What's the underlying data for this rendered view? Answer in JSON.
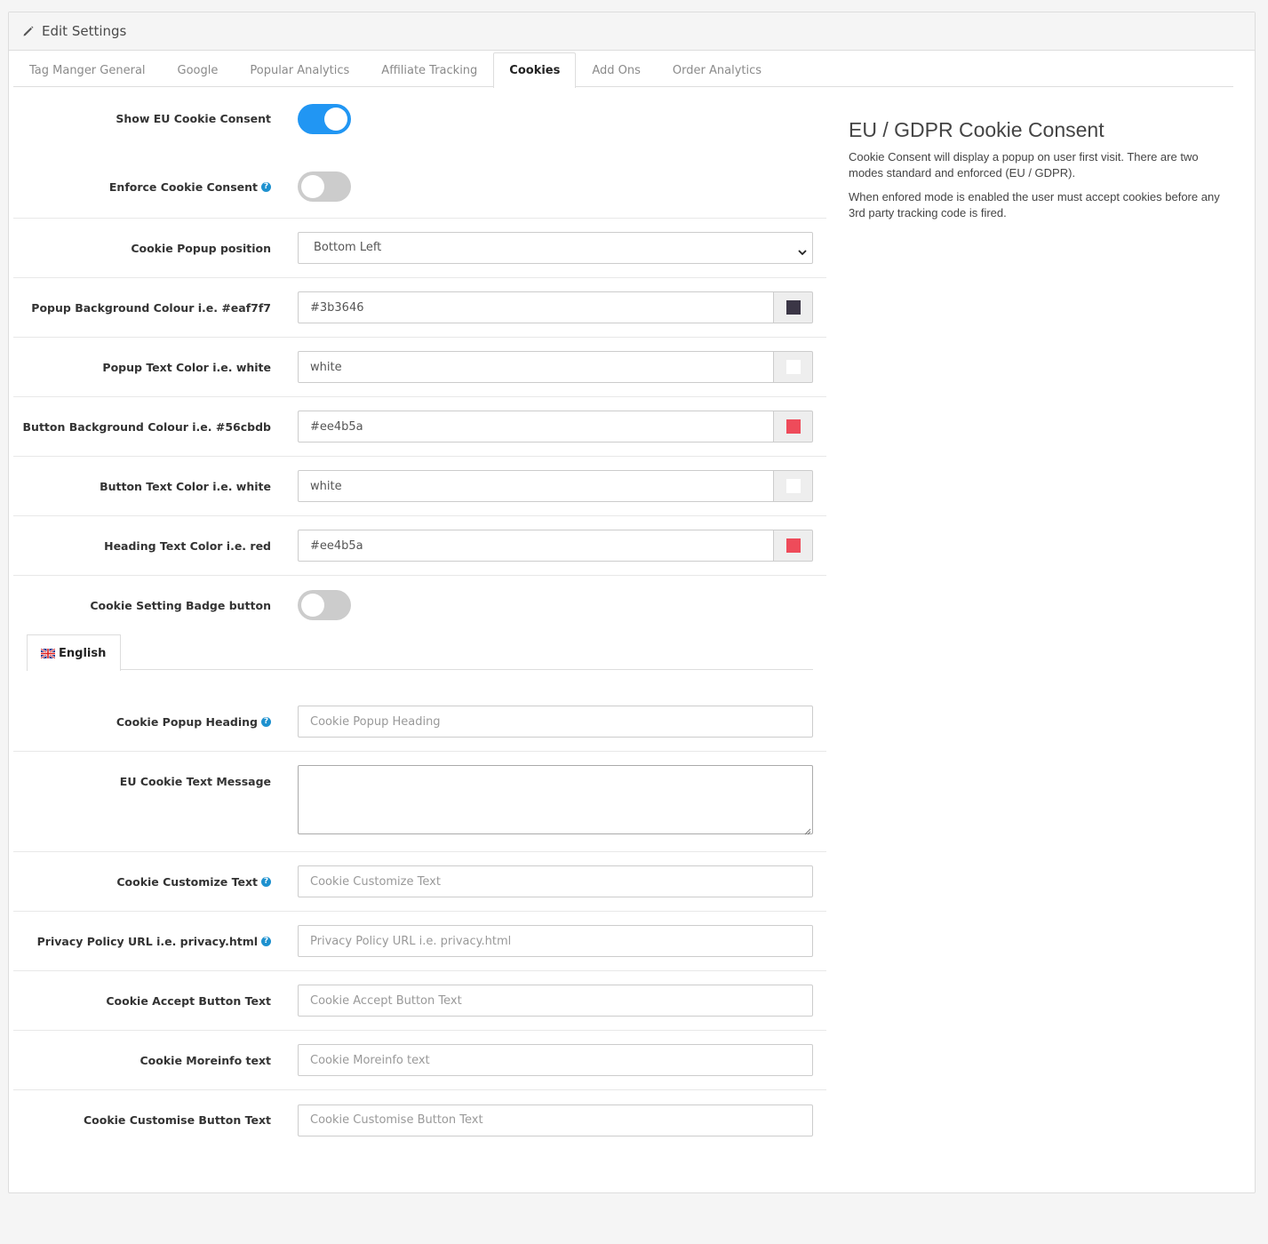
{
  "header": {
    "title": "Edit Settings",
    "icon": "pencil-icon"
  },
  "tabs": [
    {
      "label": "Tag Manger General",
      "active": false
    },
    {
      "label": "Google",
      "active": false
    },
    {
      "label": "Popular Analytics",
      "active": false
    },
    {
      "label": "Affiliate Tracking",
      "active": false
    },
    {
      "label": "Cookies",
      "active": true
    },
    {
      "label": "Add Ons",
      "active": false
    },
    {
      "label": "Order Analytics",
      "active": false
    }
  ],
  "form": {
    "show_consent": {
      "label": "Show EU Cookie Consent",
      "on": true
    },
    "enforce_consent": {
      "label": "Enforce Cookie Consent",
      "on": false
    },
    "popup_position": {
      "label": "Cookie Popup position",
      "value": "Bottom Left"
    },
    "popup_bg": {
      "label": "Popup Background Colour i.e. #eaf7f7",
      "value": "#3b3646",
      "swatch": "#3b3646"
    },
    "popup_text": {
      "label": "Popup Text Color i.e. white",
      "value": "white",
      "swatch": "#ffffff"
    },
    "button_bg": {
      "label": "Button Background Colour i.e. #56cbdb",
      "value": "#ee4b5a",
      "swatch": "#ee4b5a"
    },
    "button_text": {
      "label": "Button Text Color i.e. white",
      "value": "white",
      "swatch": "#ffffff"
    },
    "heading_text": {
      "label": "Heading Text Color i.e. red",
      "value": "#ee4b5a",
      "swatch": "#ee4b5a"
    },
    "badge_button": {
      "label": "Cookie Setting Badge button",
      "on": false
    },
    "language_tab": {
      "label": "English"
    },
    "popup_heading": {
      "label": "Cookie Popup Heading",
      "placeholder": "Cookie Popup Heading"
    },
    "text_message": {
      "label": "EU Cookie Text Message"
    },
    "customize_text": {
      "label": "Cookie Customize Text",
      "placeholder": "Cookie Customize Text"
    },
    "privacy_url": {
      "label": "Privacy Policy URL i.e. privacy.html",
      "placeholder": "Privacy Policy URL i.e. privacy.html"
    },
    "accept_text": {
      "label": "Cookie Accept Button Text",
      "placeholder": "Cookie Accept Button Text"
    },
    "moreinfo_text": {
      "label": "Cookie Moreinfo text",
      "placeholder": "Cookie Moreinfo text"
    },
    "customise_button_text": {
      "label": "Cookie Customise Button Text",
      "placeholder": "Cookie Customise Button Text"
    }
  },
  "info": {
    "title": "EU / GDPR Cookie Consent",
    "p1": "Cookie Consent will display a popup on user first visit. There are two modes standard and enforced (EU / GDPR).",
    "p2": "When enfored mode is enabled the user must accept cookies before any 3rd party tracking code is fired."
  },
  "colors": {
    "toggle_on": "#2196f3",
    "toggle_off": "#cccccc",
    "help_icon": "#1e91cf"
  }
}
